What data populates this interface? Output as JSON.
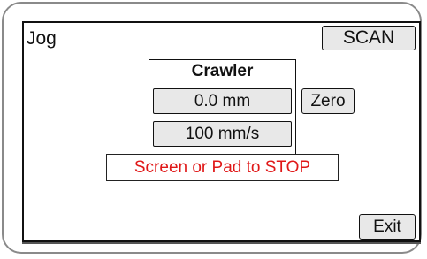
{
  "window": {
    "title": "Jog"
  },
  "toolbar": {
    "scan_label": "SCAN",
    "exit_label": "Exit"
  },
  "crawler": {
    "title": "Crawler",
    "position_value": "0.0 mm",
    "speed_value": "100 mm/s",
    "zero_label": "Zero"
  },
  "status": {
    "stop_message": "Screen or Pad to STOP",
    "stop_color": "#e01818"
  }
}
